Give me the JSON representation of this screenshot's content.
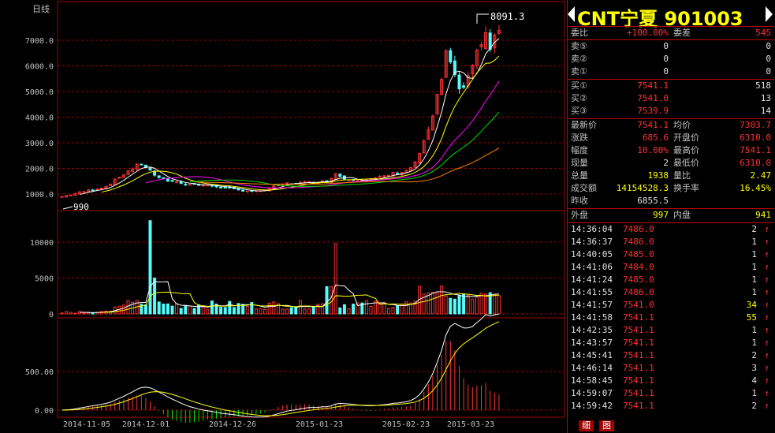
{
  "chart": {
    "period_label": "日线",
    "max_price_label": "8091.3",
    "min_price_label": "990",
    "price_axis_ticks": [
      "7000.0",
      "6000.0",
      "5000.0",
      "4000.0",
      "3000.0",
      "2000.0",
      "1000.0"
    ],
    "volume_axis_ticks": [
      "10000",
      "5000",
      "0"
    ],
    "macd_axis_ticks": [
      "500.00",
      "0.00"
    ],
    "date_labels": [
      "2014-11-05",
      "2014-12-01",
      "2014-12-26",
      "2015-01-23",
      "2015-02-23",
      "2015-03-23"
    ]
  },
  "quote": {
    "name": "CNT宁夏",
    "code": "901003",
    "wei_bi_label": "委比",
    "wei_bi_value": "+100.00%",
    "wei_cha_label": "委差",
    "wei_cha_value": "545",
    "asks": [
      {
        "label": "卖⑤",
        "price": "0",
        "vol": "0"
      },
      {
        "label": "卖②",
        "price": "0",
        "vol": "0"
      },
      {
        "label": "卖①",
        "price": "0",
        "vol": "0"
      }
    ],
    "bids": [
      {
        "label": "买①",
        "price": "7541.1",
        "vol": "518"
      },
      {
        "label": "买②",
        "price": "7541.0",
        "vol": "13"
      },
      {
        "label": "买③",
        "price": "7539.9",
        "vol": "14"
      }
    ],
    "stats": [
      {
        "l1": "最新价",
        "v1": "7541.1",
        "l2": "均价",
        "v2": "7303.7"
      },
      {
        "l1": "涨跌",
        "v1": "685.6",
        "l2": "开盘价",
        "v2": "6310.0"
      },
      {
        "l1": "幅度",
        "v1": "10.00%",
        "l2": "最高价",
        "v2": "7541.1"
      },
      {
        "l1": "现量",
        "v1": "2",
        "l2": "最低价",
        "v2": "6310.0"
      },
      {
        "l1": "总量",
        "v1": "1938",
        "l2": "量比",
        "v2": "2.47"
      },
      {
        "l1": "成交额",
        "v1": "14154528.3",
        "l2": "换手率",
        "v2": "16.45%"
      },
      {
        "l1": "昨收",
        "v1": "6855.5",
        "l2": "",
        "v2": ""
      }
    ],
    "outer_label": "外盘",
    "outer_value": "997",
    "inner_label": "内盘",
    "inner_value": "941",
    "ticks": [
      {
        "time": "14:36:04",
        "price": "7486.0",
        "vol": "2"
      },
      {
        "time": "14:36:37",
        "price": "7486.0",
        "vol": "1"
      },
      {
        "time": "14:40:05",
        "price": "7485.0",
        "vol": "1"
      },
      {
        "time": "14:41:06",
        "price": "7484.0",
        "vol": "1"
      },
      {
        "time": "14:41:24",
        "price": "7485.0",
        "vol": "1"
      },
      {
        "time": "14:41:55",
        "price": "7486.0",
        "vol": "1"
      },
      {
        "time": "14:41:57",
        "price": "7541.0",
        "vol": "34"
      },
      {
        "time": "14:41:58",
        "price": "7541.1",
        "vol": "55"
      },
      {
        "time": "14:42:35",
        "price": "7541.1",
        "vol": "1"
      },
      {
        "time": "14:43:57",
        "price": "7541.1",
        "vol": "1"
      },
      {
        "time": "14:45:41",
        "price": "7541.1",
        "vol": "2"
      },
      {
        "time": "14:46:14",
        "price": "7541.1",
        "vol": "3"
      },
      {
        "time": "14:58:45",
        "price": "7541.1",
        "vol": "4"
      },
      {
        "time": "14:59:07",
        "price": "7541.1",
        "vol": "1"
      },
      {
        "time": "14:59:42",
        "price": "7541.1",
        "vol": "2"
      }
    ],
    "tab_detail": "细",
    "tab_chart": "图"
  },
  "colors": {
    "up": "#ff3232",
    "down": "#54fcfc",
    "grid": "#a00000",
    "ma5": "#ffffff",
    "ma10": "#ffff00",
    "ma20": "#ff00ff",
    "ma30": "#00e000",
    "ma60": "#ff8000"
  }
}
